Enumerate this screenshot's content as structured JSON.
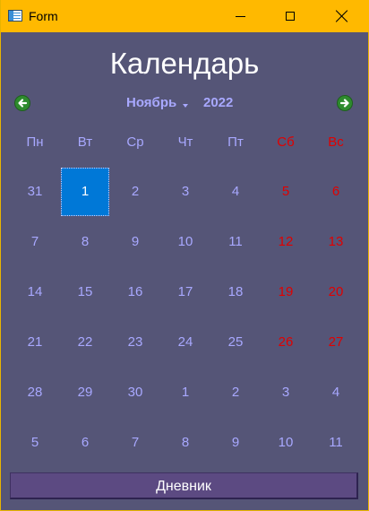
{
  "window": {
    "title": "Form"
  },
  "heading": "Календарь",
  "navigation": {
    "month": "Ноябрь",
    "year": "2022"
  },
  "weekdays": [
    "Пн",
    "Вт",
    "Ср",
    "Чт",
    "Пт",
    "Сб",
    "Вс"
  ],
  "weeks": [
    [
      "31",
      "1",
      "2",
      "3",
      "4",
      "5",
      "6"
    ],
    [
      "7",
      "8",
      "9",
      "10",
      "11",
      "12",
      "13"
    ],
    [
      "14",
      "15",
      "16",
      "17",
      "18",
      "19",
      "20"
    ],
    [
      "21",
      "22",
      "23",
      "24",
      "25",
      "26",
      "27"
    ],
    [
      "28",
      "29",
      "30",
      "1",
      "2",
      "3",
      "4"
    ],
    [
      "5",
      "6",
      "7",
      "8",
      "9",
      "10",
      "11"
    ]
  ],
  "selected_day": "1",
  "weekend_color": "#e00000",
  "weekday_color": "#a8a8ff",
  "selection_color": "#0078d7",
  "diary_button": "Дневник"
}
